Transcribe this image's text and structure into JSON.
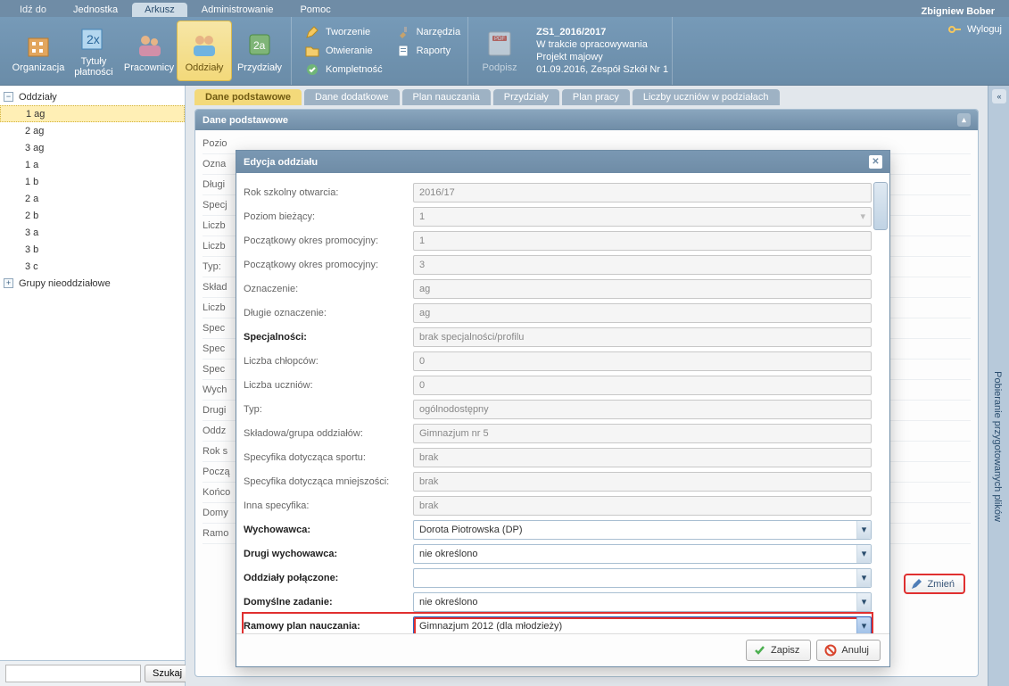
{
  "top": {
    "go_to": "Idź do",
    "tabs": [
      "Jednostka",
      "Arkusz",
      "Administrowanie",
      "Pomoc"
    ],
    "active_tab_index": 1,
    "user": "Zbigniew Bober"
  },
  "ribbon": {
    "big": [
      {
        "name": "organizacja",
        "label": "Organizacja"
      },
      {
        "name": "tytuly-platnosci",
        "label": "Tytuły płatności"
      },
      {
        "name": "pracownicy",
        "label": "Pracownicy"
      },
      {
        "name": "oddzialy",
        "label": "Oddziały",
        "active": true
      },
      {
        "name": "przydzialy",
        "label": "Przydziały"
      }
    ],
    "small_col1": [
      {
        "name": "tworzenie",
        "label": "Tworzenie"
      },
      {
        "name": "otwieranie",
        "label": "Otwieranie"
      },
      {
        "name": "kompletnosc",
        "label": "Kompletność"
      }
    ],
    "small_col2": [
      {
        "name": "narzedzia",
        "label": "Narzędzia"
      },
      {
        "name": "raporty",
        "label": "Raporty"
      }
    ],
    "pdf_label": "Podpisz",
    "info": {
      "line1": "ZS1_2016/2017",
      "line2": "W trakcie opracowywania",
      "line3": "Projekt majowy",
      "line4": "01.09.2016, Zespół Szkół Nr 1"
    },
    "logout": "Wyloguj"
  },
  "sidebar": {
    "root1": "Oddziały",
    "items": [
      "1 ag",
      "2 ag",
      "3 ag",
      "1 a",
      "1 b",
      "2 a",
      "2 b",
      "3 a",
      "3 b",
      "3 c"
    ],
    "selected_index": 0,
    "root2": "Grupy nieoddziałowe",
    "search_value": "",
    "search_btn": "Szukaj"
  },
  "content": {
    "tabs": [
      "Dane podstawowe",
      "Dane dodatkowe",
      "Plan nauczania",
      "Przydziały",
      "Plan pracy",
      "Liczby uczniów w podziałach"
    ],
    "active_tab_index": 0,
    "panel_title": "Dane podstawowe",
    "bg_rows": [
      "Pozio",
      "Ozna",
      "Długi",
      "Specj",
      "Liczb",
      "Liczb",
      "Typ:",
      "Skład",
      "Liczb",
      "Spec",
      "Spec",
      "Spec",
      "Wych",
      "Drugi",
      "Oddz",
      "Rok s",
      "Począ",
      "Końco",
      "Domy",
      "Ramo"
    ],
    "change_btn": "Zmień"
  },
  "right_bar": {
    "label": "Pobieranie przygotowanych plików"
  },
  "modal": {
    "title": "Edycja oddziału",
    "rows": [
      {
        "label": "Rok szkolny otwarcia:",
        "value": "2016/17",
        "kind": "disabled"
      },
      {
        "label": "Poziom bieżący:",
        "value": "1",
        "kind": "disabled-combo"
      },
      {
        "label": "Początkowy okres promocyjny:",
        "value": "1",
        "kind": "disabled"
      },
      {
        "label": "Początkowy okres promocyjny:",
        "value": "3",
        "kind": "disabled"
      },
      {
        "label": "Oznaczenie:",
        "value": "ag",
        "kind": "disabled"
      },
      {
        "label": "Długie oznaczenie:",
        "value": "ag",
        "kind": "disabled"
      },
      {
        "label": "Specjalności:",
        "value": "brak specjalności/profilu",
        "kind": "disabled",
        "bold": true
      },
      {
        "label": "Liczba chłopców:",
        "value": "0",
        "kind": "disabled"
      },
      {
        "label": "Liczba uczniów:",
        "value": "0",
        "kind": "disabled"
      },
      {
        "label": "Typ:",
        "value": "ogólnodostępny",
        "kind": "disabled"
      },
      {
        "label": "Składowa/grupa oddziałów:",
        "value": "Gimnazjum nr 5",
        "kind": "disabled"
      },
      {
        "label": "Specyfika dotycząca sportu:",
        "value": "brak",
        "kind": "disabled"
      },
      {
        "label": "Specyfika dotycząca mniejszości:",
        "value": "brak",
        "kind": "disabled"
      },
      {
        "label": "Inna specyfika:",
        "value": "brak",
        "kind": "disabled"
      },
      {
        "label": "Wychowawca:",
        "value": "Dorota Piotrowska (DP)",
        "kind": "select",
        "bold": true
      },
      {
        "label": "Drugi wychowawca:",
        "value": "nie określono",
        "kind": "select",
        "bold": true
      },
      {
        "label": "Oddziały połączone:",
        "value": "",
        "kind": "select",
        "bold": true
      },
      {
        "label": "Domyślne zadanie:",
        "value": "nie określono",
        "kind": "select",
        "bold": true
      },
      {
        "label": "Ramowy plan nauczania:",
        "value": "Gimnazjum 2012 (dla młodzieży)",
        "kind": "select-highlight",
        "bold": true
      }
    ],
    "save": "Zapisz",
    "cancel": "Anuluj"
  }
}
